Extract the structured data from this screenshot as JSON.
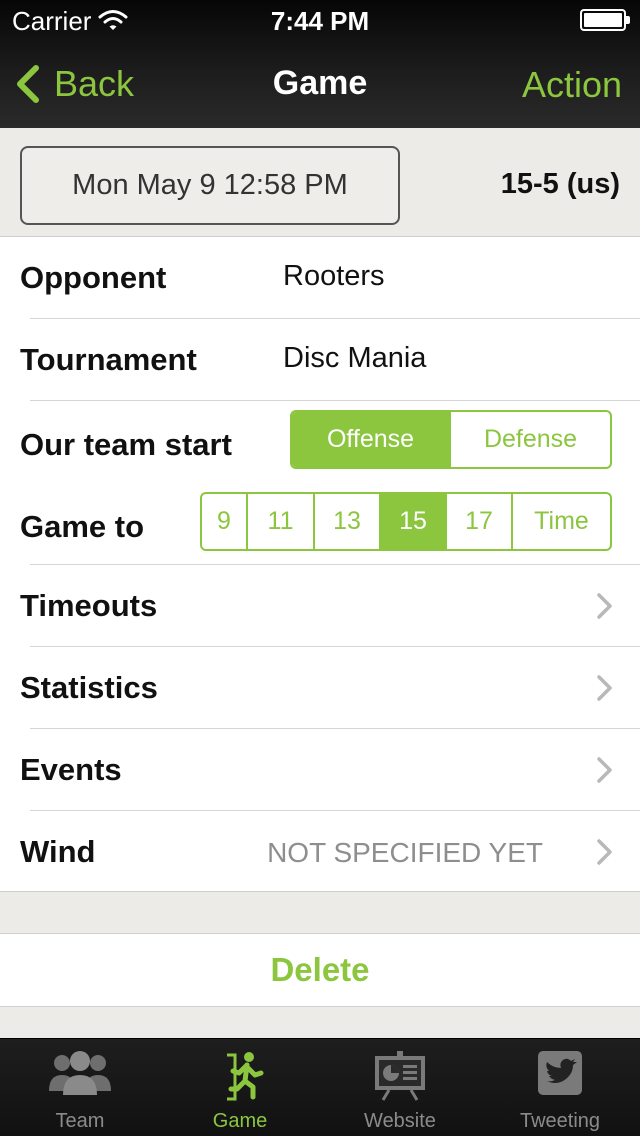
{
  "status_bar": {
    "carrier": "Carrier",
    "time": "7:44 PM"
  },
  "nav": {
    "back_label": "Back",
    "title": "Game",
    "action_label": "Action"
  },
  "game": {
    "date": "Mon May 9 12:58 PM",
    "score": "15-5 (us)"
  },
  "rows": {
    "opponent": {
      "label": "Opponent",
      "value": "Rooters"
    },
    "tournament": {
      "label": "Tournament",
      "value": "Disc Mania"
    },
    "team_start": {
      "label": "Our team start",
      "options": [
        "Offense",
        "Defense"
      ],
      "selected": "Offense"
    },
    "game_to": {
      "label": "Game to",
      "options": [
        "9",
        "11",
        "13",
        "15",
        "17",
        "Time"
      ],
      "selected": "15"
    },
    "timeouts": {
      "label": "Timeouts"
    },
    "statistics": {
      "label": "Statistics"
    },
    "events": {
      "label": "Events"
    },
    "wind": {
      "label": "Wind",
      "detail": "NOT SPECIFIED YET"
    }
  },
  "delete_label": "Delete",
  "tabs": [
    {
      "label": "Team",
      "icon": "team-icon"
    },
    {
      "label": "Game",
      "icon": "running-man-icon"
    },
    {
      "label": "Website",
      "icon": "presentation-board-icon"
    },
    {
      "label": "Tweeting",
      "icon": "twitter-bird-icon"
    }
  ],
  "colors": {
    "accent": "#8cc63f",
    "nav_background": "#1c1c1c",
    "page_background": "#ecebe8"
  }
}
